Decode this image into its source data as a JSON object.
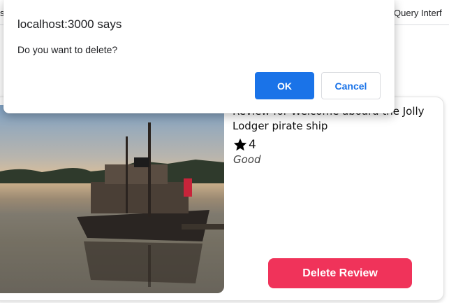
{
  "browser": {
    "left_fragment": "s",
    "right_fragment": "Query Interf"
  },
  "dialog": {
    "title": "localhost:3000 says",
    "message": "Do you want to delete?",
    "ok_label": "OK",
    "cancel_label": "Cancel",
    "ok_color": "#1a73e8"
  },
  "review": {
    "heading": "Review for Welcome aboard the Jolly Lodger pirate ship",
    "rating": "4",
    "rating_icon": "star-icon",
    "text": "Good",
    "delete_label": "Delete Review",
    "delete_color": "#f0335a"
  }
}
